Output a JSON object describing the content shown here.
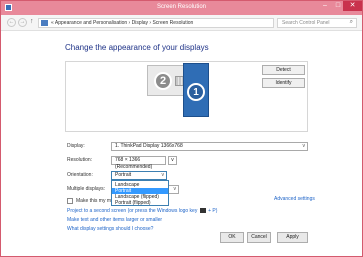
{
  "window": {
    "title": "Screen Resolution",
    "min_glyph": "–",
    "max_glyph": "□",
    "close_glyph": "✕"
  },
  "address": {
    "back_glyph": "←",
    "fwd_glyph": "→",
    "up_glyph": "↑",
    "crumbs": "« Appearance and Personalisation  ›  Display  ›  Screen Resolution",
    "dropdown_glyph": "v",
    "refresh_glyph": "↻",
    "search_placeholder": "Search Control Panel",
    "search_glyph": "⌕"
  },
  "page": {
    "heading": "Change the appearance of your displays"
  },
  "preview": {
    "monitor_secondary_number": "2",
    "monitor_primary_number": "1",
    "detect_label": "Detect",
    "identify_label": "Identify"
  },
  "settings": {
    "display_label": "Display:",
    "display_value": "1. ThinkPad Display 1366x768",
    "resolution_label": "Resolution:",
    "resolution_value": "768 × 1366 (Recommended)",
    "orientation_label": "Orientation:",
    "orientation_value": "Portrait",
    "multiple_label": "Multiple displays:",
    "multiple_value": "",
    "arrow_glyph": "v",
    "orientation_options": [
      "Landscape",
      "Portrait",
      "Landscape (flipped)",
      "Portrait (flipped)"
    ],
    "orientation_selected_index": 1
  },
  "links": {
    "main_display_checkbox": "Make this my main display",
    "advanced": "Advanced settings",
    "project_prefix": "Project to a second screen (or press the Windows logo key",
    "project_suffix": "+ P)",
    "text_size": "Make text and other items larger or smaller",
    "which_settings": "What display settings should I choose?"
  },
  "footer": {
    "ok": "OK",
    "cancel": "Cancel",
    "apply": "Apply"
  },
  "colors": {
    "titlebar": "#e8899a",
    "accent_link": "#1e64c8",
    "heading": "#1e3287",
    "selection": "#3399ff",
    "monitor_primary": "#2f6db5"
  }
}
